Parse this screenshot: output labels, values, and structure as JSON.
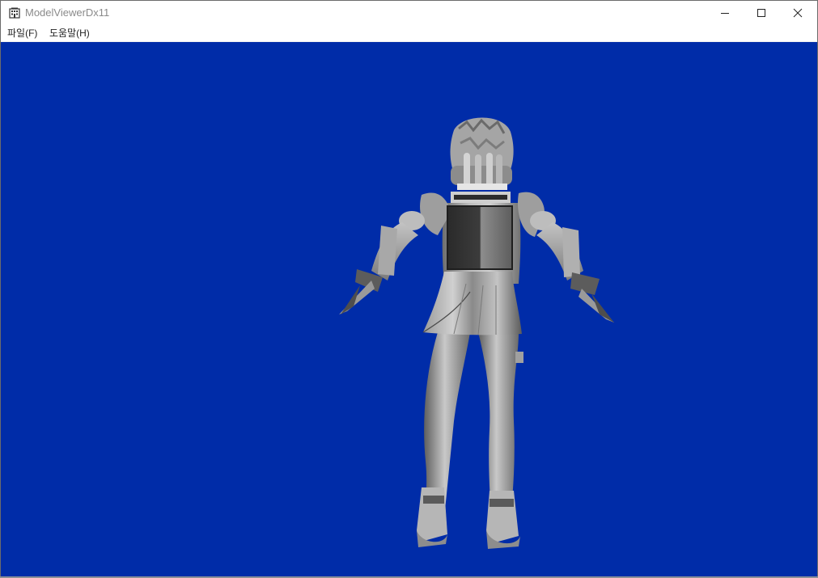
{
  "window": {
    "title": "ModelViewerDx11",
    "app_icon": "building-icon",
    "controls": {
      "minimize_icon": "minimize-icon",
      "maximize_icon": "maximize-icon",
      "close_icon": "close-icon"
    }
  },
  "menu": {
    "file_label": "파일(F)",
    "help_label": "도움말(H)"
  },
  "viewport": {
    "background_color": "#002ca8",
    "content": "3d-model-render"
  }
}
